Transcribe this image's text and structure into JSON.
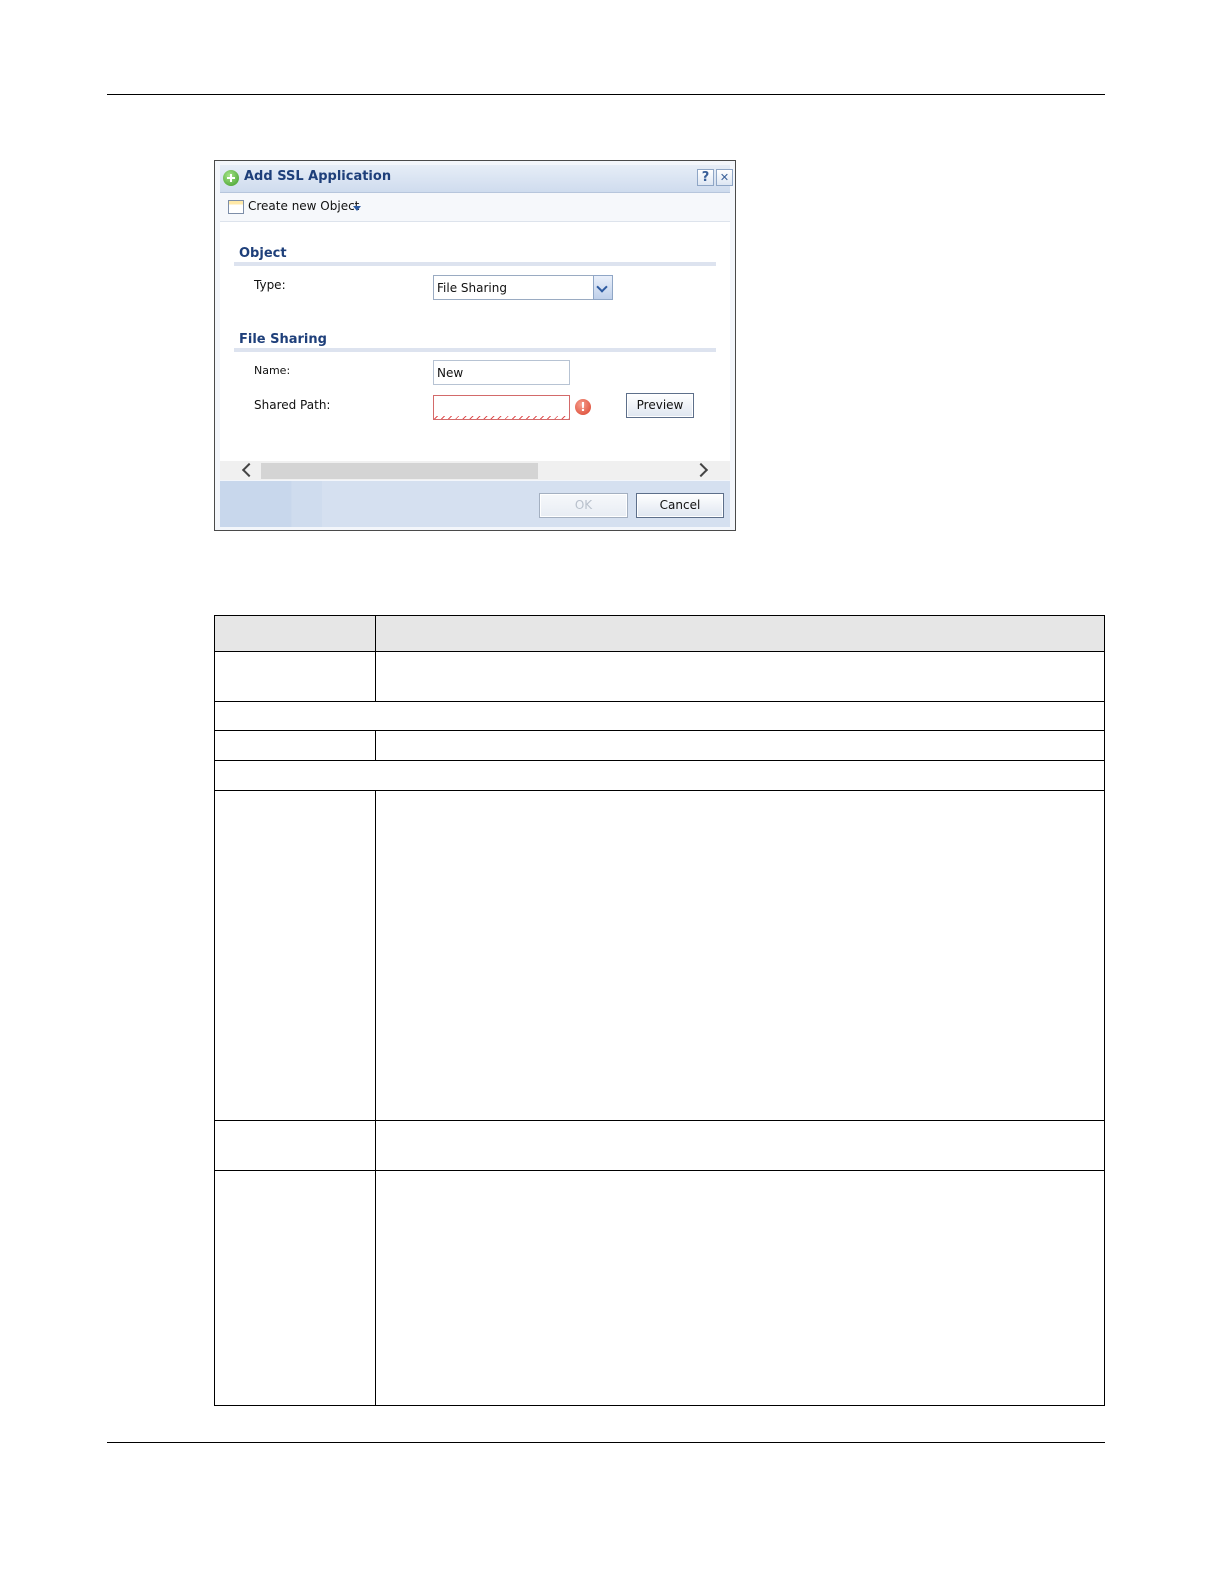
{
  "dialog": {
    "title": "Add SSL Application",
    "help_label": "?",
    "close_label": "✕",
    "toolbar": {
      "create_label": "Create new Object"
    },
    "object_section": {
      "heading": "Object",
      "type_label": "Type:",
      "type_value": "File Sharing"
    },
    "file_sharing_section": {
      "heading": "File Sharing",
      "name_label": "Name:",
      "name_value": "New",
      "shared_path_label": "Shared Path:",
      "shared_path_value": "",
      "error_icon_text": "!",
      "preview_label": "Preview"
    },
    "ok_label": "OK",
    "cancel_label": "Cancel"
  },
  "table": {
    "columns": [
      "",
      ""
    ],
    "rows": [
      [
        "",
        ""
      ],
      [
        ""
      ],
      [
        "",
        ""
      ],
      [
        ""
      ],
      [
        "",
        ""
      ],
      [
        "",
        ""
      ],
      [
        "",
        ""
      ]
    ]
  },
  "icons": {
    "title": "add-icon",
    "toolbar": "object-icon",
    "error": "warning-icon",
    "scroll_left": "chevron-left-icon",
    "scroll_right": "chevron-right-icon"
  }
}
